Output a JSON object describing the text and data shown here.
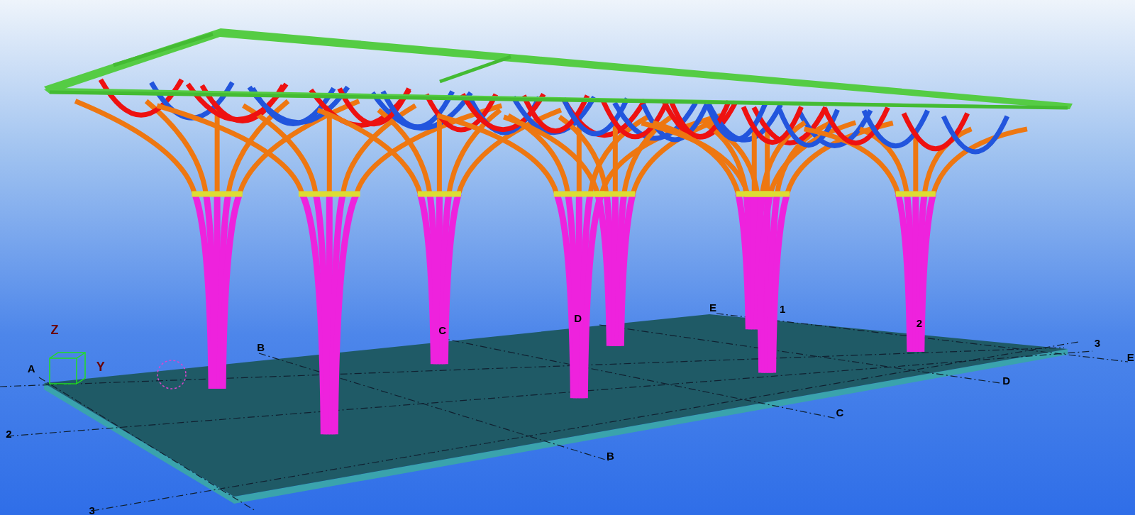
{
  "viewport": {
    "axis_labels": [
      "Z",
      "Y"
    ],
    "grid_labels": [
      "A",
      "B",
      "C",
      "D",
      "E",
      "1",
      "2",
      "3",
      "E",
      "2",
      "3",
      "B",
      "C",
      "D"
    ]
  }
}
